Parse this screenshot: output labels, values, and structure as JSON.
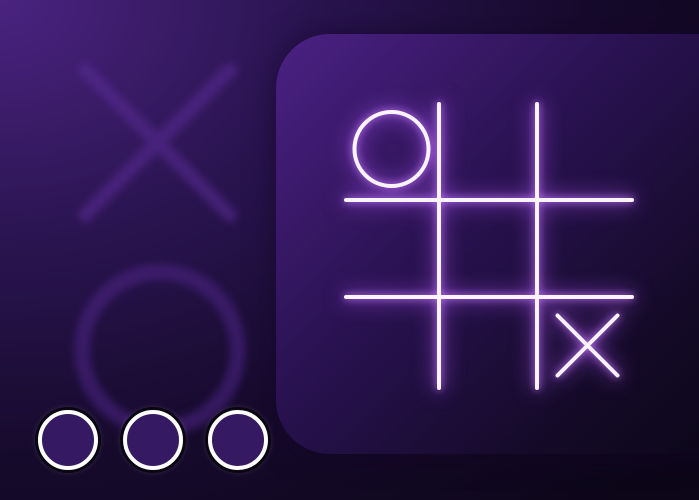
{
  "game": {
    "name": "tic-tac-toe",
    "board": [
      [
        "O",
        "",
        ""
      ],
      [
        "",
        "",
        ""
      ],
      [
        "",
        "",
        "X"
      ]
    ],
    "background_glyphs": [
      "X",
      "O"
    ],
    "indicator_dots": 3
  },
  "colors": {
    "glow": "#c77dff",
    "line": "#fbf3ff",
    "background_top_left": "#4a2380",
    "background_dark": "#0a0612",
    "dot_fill": "#351a63"
  }
}
